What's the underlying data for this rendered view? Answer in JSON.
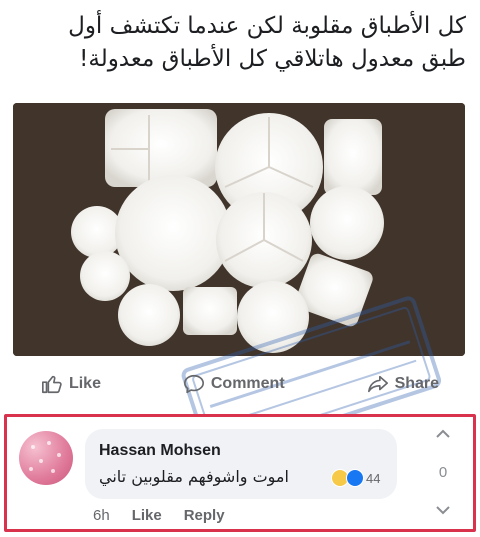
{
  "post": {
    "text_line1": "كل الأطباق مقلوبة لكن عندما تكتشف أول",
    "text_line2": "طبق معدول هاتلاقي كل الأطباق معدولة!"
  },
  "actions": {
    "like": "Like",
    "comment": "Comment",
    "share": "Share"
  },
  "comment": {
    "author": "Hassan Mohsen",
    "text": "اموت واشوفهم مقلوبين تاني",
    "reaction_count": "44",
    "time": "6h",
    "like": "Like",
    "reply": "Reply",
    "vote_count": "0"
  },
  "colors": {
    "highlight_border": "#d9324c",
    "facebook_blue": "#1877f2"
  }
}
